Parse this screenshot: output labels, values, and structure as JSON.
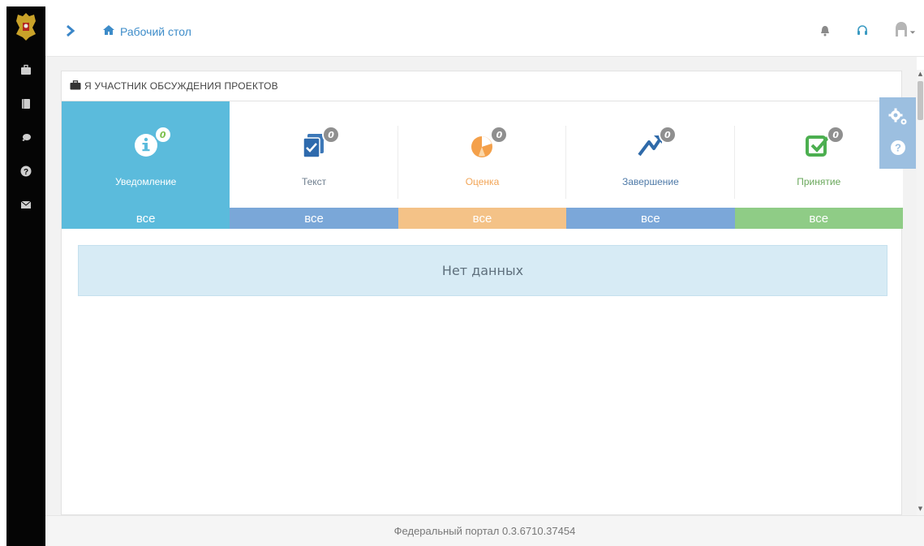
{
  "topbar": {
    "breadcrumb": "Рабочий стол",
    "icons": [
      "bell-icon",
      "headset-icon",
      "user-icon"
    ]
  },
  "sidebar": {
    "icons": [
      "briefcase-icon",
      "book-icon",
      "chat-icon",
      "question-icon",
      "envelope-icon"
    ]
  },
  "panel": {
    "title": "Я УЧАСТНИК ОБСУЖДЕНИЯ ПРОЕКТОВ",
    "tiles": [
      {
        "label": "Уведомление",
        "count": "0",
        "all": "все",
        "icon": "info-icon",
        "label_color": "#ffffff",
        "bar_color": "#5bbbdc"
      },
      {
        "label": "Текст",
        "count": "0",
        "all": "все",
        "icon": "document-check-icon",
        "label_color": "#6f7f8f",
        "bar_color": "#7aa7d8"
      },
      {
        "label": "Оценка",
        "count": "0",
        "all": "все",
        "icon": "pie-chart-icon",
        "label_color": "#f2a557",
        "bar_color": "#f4c287"
      },
      {
        "label": "Завершение",
        "count": "0",
        "all": "все",
        "icon": "flag-icon",
        "label_color": "#4f7aa8",
        "bar_color": "#7ba7d9"
      },
      {
        "label": "Принятие",
        "count": "0",
        "all": "все",
        "icon": "checkbox-icon",
        "label_color": "#6aa85c",
        "bar_color": "#8fcc86"
      }
    ],
    "empty_message": "Нет данных"
  },
  "footer": {
    "text": "Федеральный портал 0.3.6710.37454"
  },
  "colors": {
    "sidebar": "#050505",
    "accent": "#3d8cc9",
    "active_tile": "#5bbbdc"
  }
}
